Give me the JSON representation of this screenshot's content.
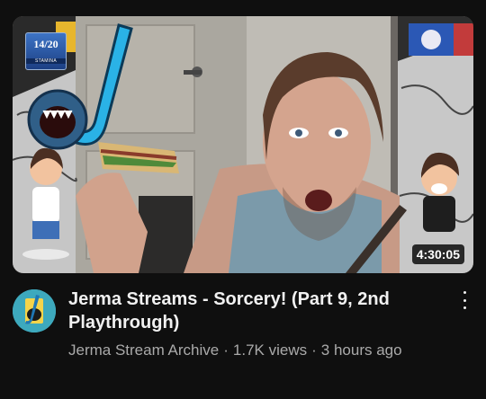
{
  "video": {
    "title": "Jerma Streams - Sorcery! (Part 9, 2nd Playthrough)",
    "duration": "4:30:05",
    "channel": "Jerma Stream Archive",
    "views": "1.7K views",
    "age": "3 hours ago",
    "separator": "·"
  },
  "overlay": {
    "stamina_value": "14/20",
    "stamina_label": "STAMINA"
  },
  "icons": {
    "menu": "more-vert-icon",
    "channel_avatar": "channel-avatar"
  }
}
